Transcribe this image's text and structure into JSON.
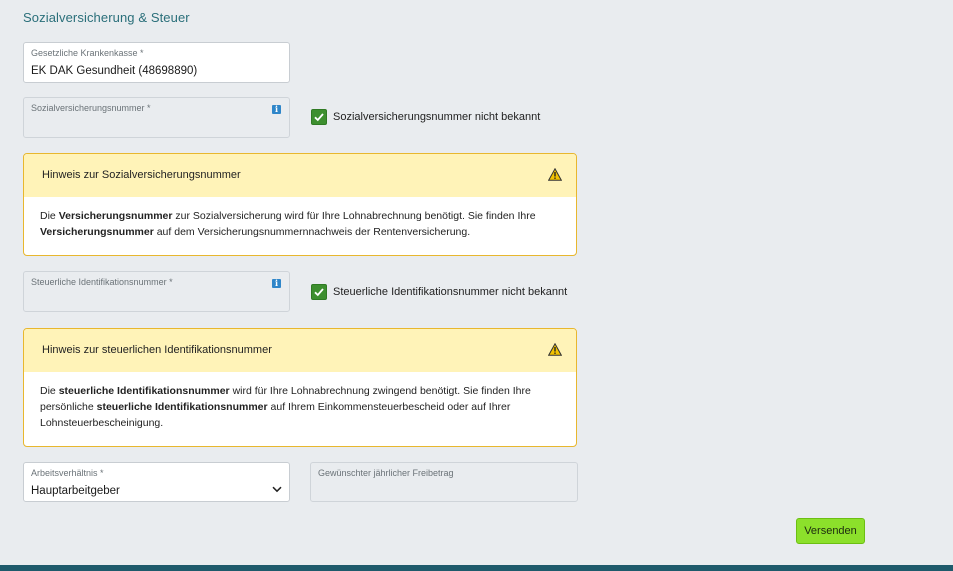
{
  "section": {
    "title": "Sozialversicherung & Steuer"
  },
  "krankenkasse": {
    "label": "Gesetzliche Krankenkasse *",
    "value": "EK DAK Gesundheit (48698890)"
  },
  "svnr": {
    "label": "Sozialversicherungsnummer *",
    "checkbox_label": "Sozialversicherungsnummer nicht bekannt",
    "checked": true
  },
  "svnr_notice": {
    "title": "Hinweis zur Sozialversicherungsnummer",
    "p1": "Die ",
    "b1": "Versicherungsnummer",
    "p2": " zur Sozialversicherung wird für Ihre Lohnabrechnung benötigt. Sie finden Ihre ",
    "b2": "Versicherungsnummer",
    "p3": " auf dem Versicherungsnummernnachweis der Rentenversicherung."
  },
  "steuerid": {
    "label": "Steuerliche Identifikationsnummer *",
    "checkbox_label": "Steuerliche Identifikationsnummer nicht bekannt",
    "checked": true
  },
  "steuerid_notice": {
    "title": "Hinweis zur steuerlichen Identifikationsnummer",
    "p1": "Die ",
    "b1": "steuerliche Identifikationsnummer",
    "p2": " wird für Ihre Lohnabrechnung zwingend benötigt. Sie finden Ihre persönliche ",
    "b2": "steuerliche Identifikationsnummer",
    "p3": " auf Ihrem Einkommensteuerbescheid oder auf Ihrer Lohnsteuerbescheinigung."
  },
  "arbeitsverhaeltnis": {
    "label": "Arbeitsverhältnis *",
    "value": "Hauptarbeitgeber"
  },
  "freibetrag": {
    "label": "Gewünschter jährlicher Freibetrag",
    "value": ""
  },
  "actions": {
    "submit_label": "Versenden"
  },
  "icons": {
    "info": "info-icon",
    "warning": "warning-icon",
    "check": "check-icon",
    "chevron": "chevron-down-icon"
  },
  "colors": {
    "accent_title": "#2a6f7a",
    "checkbox": "#3d8f2f",
    "notice_border": "#e8b72e",
    "notice_head": "#fff3b8",
    "submit": "#8ce02b",
    "footer": "#1e5a6b"
  }
}
